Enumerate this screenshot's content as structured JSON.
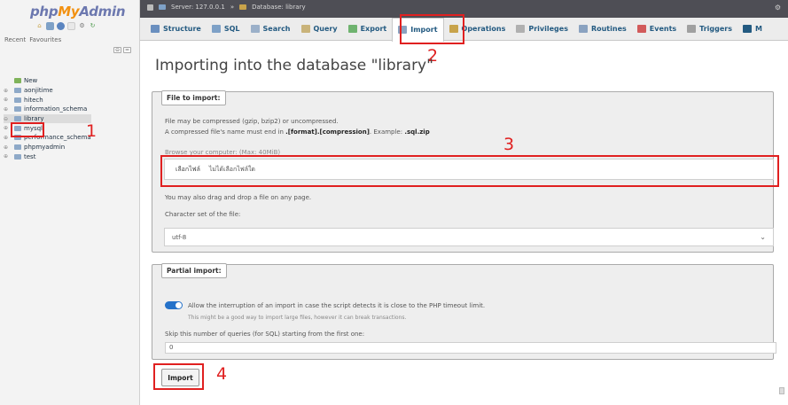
{
  "sidebar": {
    "logo": {
      "php": "php",
      "my": "My",
      "admin": "Admin"
    },
    "quick_icons": [
      "home-icon",
      "database-icon",
      "info-icon",
      "docs-icon",
      "settings-icon",
      "reload-icon"
    ],
    "tabs": [
      "Recent",
      "Favourites"
    ],
    "tree": [
      {
        "label": "New",
        "expander": "",
        "selected": false
      },
      {
        "label": "aonjitime",
        "expander": "⊕",
        "selected": false
      },
      {
        "label": "hitech",
        "expander": "⊕",
        "selected": false
      },
      {
        "label": "information_schema",
        "expander": "⊕",
        "selected": false
      },
      {
        "label": "library",
        "expander": "⊖",
        "selected": true
      },
      {
        "label": "mysql",
        "expander": "⊕",
        "selected": false
      },
      {
        "label": "performance_schema",
        "expander": "⊕",
        "selected": false
      },
      {
        "label": "phpmyadmin",
        "expander": "⊕",
        "selected": false
      },
      {
        "label": "test",
        "expander": "⊕",
        "selected": false
      }
    ]
  },
  "topbar": {
    "server": "Server: 127.0.0.1",
    "separator": "»",
    "database": "Database: library"
  },
  "tabs": [
    {
      "label": "Structure",
      "icon": "structure-icon",
      "color": "#6a8fbf",
      "active": false
    },
    {
      "label": "SQL",
      "icon": "sql-icon",
      "color": "#7ea1c7",
      "active": false
    },
    {
      "label": "Search",
      "icon": "search-icon",
      "color": "#9bb0c9",
      "active": false
    },
    {
      "label": "Query",
      "icon": "query-icon",
      "color": "#c9b37a",
      "active": false
    },
    {
      "label": "Export",
      "icon": "export-icon",
      "color": "#6fb36f",
      "active": false
    },
    {
      "label": "Import",
      "icon": "import-icon",
      "color": "#8aa2c0",
      "active": true
    },
    {
      "label": "Operations",
      "icon": "operations-icon",
      "color": "#c8a34a",
      "active": false
    },
    {
      "label": "Privileges",
      "icon": "privileges-icon",
      "color": "#b0b0b0",
      "active": false
    },
    {
      "label": "Routines",
      "icon": "routines-icon",
      "color": "#8aa2c0",
      "active": false
    },
    {
      "label": "Events",
      "icon": "events-icon",
      "color": "#d25a5a",
      "active": false
    },
    {
      "label": "Triggers",
      "icon": "triggers-icon",
      "color": "#a0a0a0",
      "active": false
    },
    {
      "label": "M",
      "icon": "more-icon",
      "color": "#235a81",
      "active": false
    }
  ],
  "main": {
    "title": "Importing into the database \"library\"",
    "file_section": {
      "legend": "File to import:",
      "line1": "File may be compressed (gzip, bzip2) or uncompressed.",
      "line2_prefix": "A compressed file's name must end in ",
      "line2_format": ".[format].[compression]",
      "line2_mid": ". Example: ",
      "line2_example": ".sql.zip",
      "browse_label": "Browse your computer: (Max: 40MiB)",
      "choose_button": "เลือกไฟล์",
      "no_file": "ไม่ได้เลือกไฟล์ใด",
      "drag_hint": "You may also drag and drop a file on any page.",
      "charset_label": "Character set of the file:",
      "charset_value": "utf-8"
    },
    "partial_section": {
      "legend": "Partial import:",
      "allow_text": "Allow the interruption of an import in case the script detects it is close to the PHP timeout limit.",
      "allow_hint": "This might be a good way to import large files, however it can break transactions.",
      "allow_checked": true,
      "skip_label": "Skip this number of queries (for SQL) starting from the first one:",
      "skip_value": "0"
    },
    "import_button": "Import"
  },
  "annotations": {
    "n1": "1",
    "n2": "2",
    "n3": "3",
    "n4": "4",
    "color": "#e02020"
  }
}
